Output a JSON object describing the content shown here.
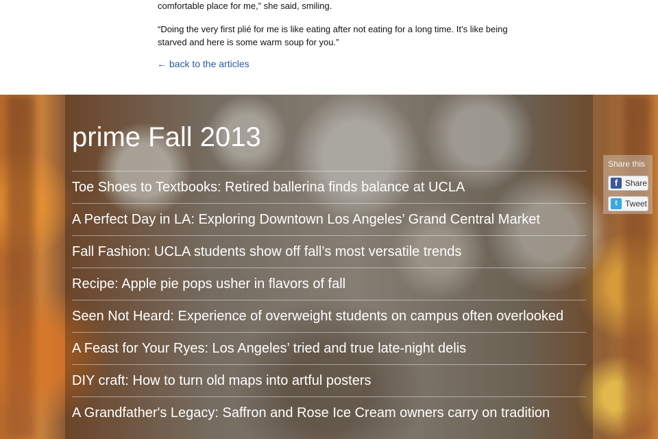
{
  "article": {
    "paragraph_end": "comfortable place for me,” she said, smiling.",
    "quote": "“Doing the very first plié for me is like eating after not eating for a long time. It’s like being starved and here is some warm soup for you.”",
    "back_link": "← back to the articles"
  },
  "edition": {
    "title": "prime Fall 2013",
    "articles": [
      "Toe Shoes to Textbooks: Retired ballerina finds balance at UCLA",
      "A Perfect Day in LA: Exploring Downtown Los Angeles’ Grand Central Market",
      "Fall Fashion: UCLA students show off fall’s most versatile trends",
      "Recipe: Apple pie pops usher in flavors of fall",
      "Seen Not Heard: Experience of overweight students on campus often overlooked",
      "A Feast for Your Ryes: Los Angeles’ tried and true late-night delis",
      "DIY craft: How to turn old maps into artful posters",
      "A Grandfather's Legacy: Saffron and Rose Ice Cream owners carry on tradition"
    ]
  },
  "share": {
    "label": "Share this",
    "facebook": "Share",
    "twitter": "Tweet",
    "facebook_icon": "f",
    "twitter_icon": "t"
  },
  "colors": {
    "link": "#2a5a9e",
    "facebook": "#3b5998",
    "twitter": "#39a9e0"
  }
}
